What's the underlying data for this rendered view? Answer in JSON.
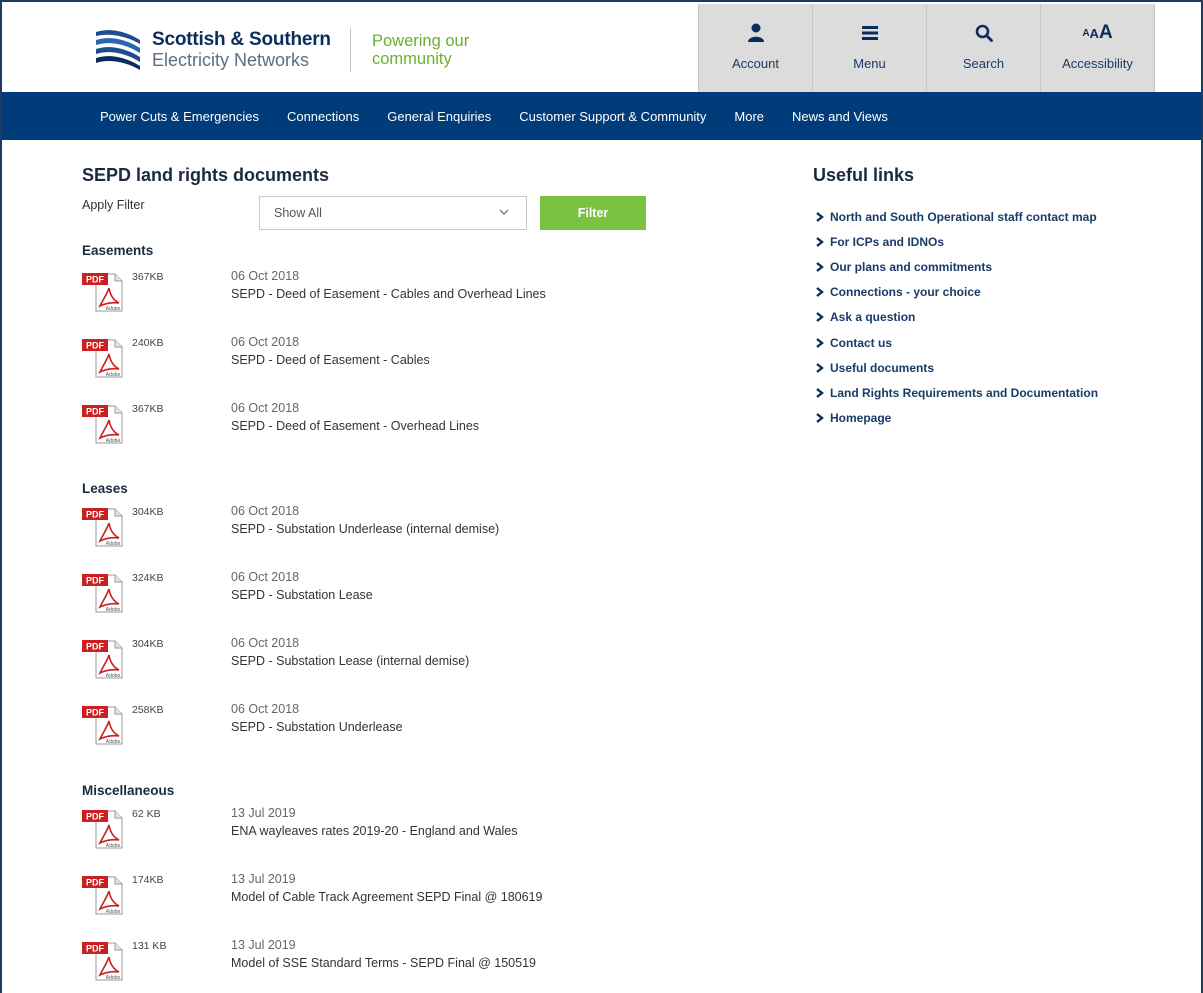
{
  "brand": {
    "name_line1": "Scottish & Southern",
    "name_line2": "Electricity Networks",
    "tagline_line1": "Powering our",
    "tagline_line2": "community"
  },
  "header_buttons": [
    {
      "label": "Account",
      "icon": "user-icon"
    },
    {
      "label": "Menu",
      "icon": "menu-icon"
    },
    {
      "label": "Search",
      "icon": "search-icon"
    },
    {
      "label": "Accessibility",
      "icon": "text-size-icon",
      "glyph": "AAA"
    }
  ],
  "nav": [
    "Power Cuts & Emergencies",
    "Connections",
    "General Enquiries",
    "Customer Support & Community",
    "More",
    "News and Views"
  ],
  "main": {
    "title": "SEPD land rights documents",
    "filter_label": "Apply Filter",
    "filter_selected": "Show All",
    "filter_button": "Filter",
    "sections": [
      {
        "heading": "Easements",
        "docs": [
          {
            "size": "367KB",
            "date": "06 Oct 2018",
            "title": "SEPD - Deed of Easement - Cables and Overhead Lines"
          },
          {
            "size": "240KB",
            "date": "06 Oct 2018",
            "title": "SEPD - Deed of Easement - Cables"
          },
          {
            "size": "367KB",
            "date": "06 Oct 2018",
            "title": "SEPD - Deed of Easement - Overhead Lines"
          }
        ]
      },
      {
        "heading": "Leases",
        "docs": [
          {
            "size": "304KB",
            "date": "06 Oct 2018",
            "title": "SEPD - Substation Underlease (internal demise)"
          },
          {
            "size": "324KB",
            "date": "06 Oct 2018",
            "title": "SEPD - Substation Lease"
          },
          {
            "size": "304KB",
            "date": "06 Oct 2018",
            "title": "SEPD - Substation Lease (internal demise)"
          },
          {
            "size": "258KB",
            "date": "06 Oct 2018",
            "title": "SEPD - Substation Underlease"
          }
        ]
      },
      {
        "heading": "Miscellaneous",
        "docs": [
          {
            "size": "62 KB",
            "date": "13 Jul 2019",
            "title": "ENA wayleaves rates 2019-20 - England and Wales"
          },
          {
            "size": "174KB",
            "date": "13 Jul 2019",
            "title": "Model of Cable Track Agreement SEPD Final @ 180619"
          },
          {
            "size": "131 KB",
            "date": "13 Jul 2019",
            "title": "Model of SSE Standard Terms - SEPD Final @ 150519"
          }
        ]
      }
    ],
    "pdf_icon": {
      "label": "PDF",
      "sublabel": "Adobe"
    }
  },
  "useful_links": {
    "title": "Useful links",
    "items": [
      "North and South Operational staff contact map",
      "For ICPs and IDNOs",
      "Our plans and commitments",
      "Connections - your choice",
      "Ask a question",
      "Contact us",
      "Useful documents",
      "Land Rights Requirements and Documentation",
      "Homepage"
    ]
  },
  "colors": {
    "nav_bg": "#003b7a",
    "brand_navy": "#0b2d5e",
    "tagline_green": "#68b22e",
    "filter_green": "#7cc242",
    "header_button_bg": "#dcdcdc",
    "pdf_red": "#cc1f1f"
  }
}
